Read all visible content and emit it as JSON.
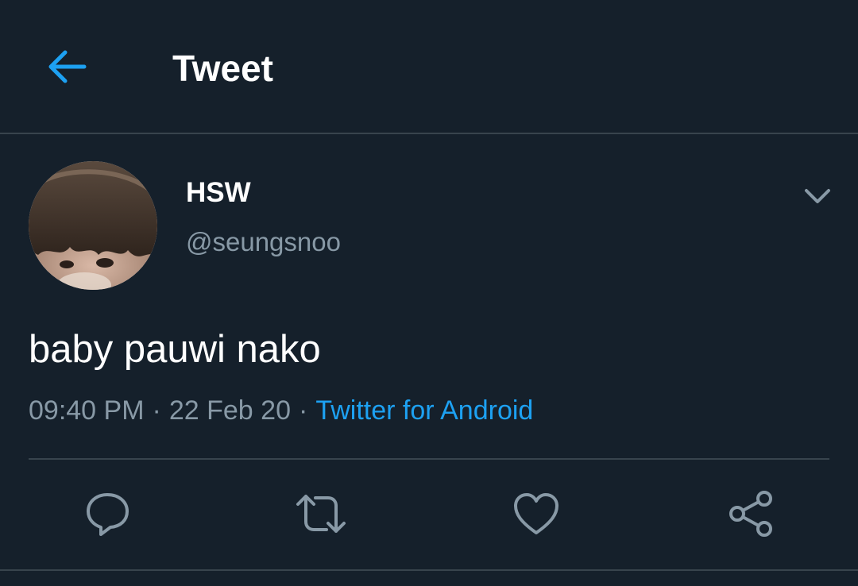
{
  "header": {
    "title": "Tweet",
    "back_icon": "arrow-left-icon"
  },
  "tweet": {
    "author": {
      "display_name": "HSW",
      "handle": "@seungsnoo"
    },
    "text": "baby pauwi nako",
    "time": "09:40 PM",
    "date": "22 Feb 20",
    "separator": "·",
    "source": "Twitter for Android"
  },
  "actions": [
    {
      "icon": "reply-icon"
    },
    {
      "icon": "retweet-icon"
    },
    {
      "icon": "like-icon"
    },
    {
      "icon": "share-icon"
    }
  ],
  "colors": {
    "background": "#15202b",
    "accent": "#1da1f2",
    "secondary_text": "#8899a6",
    "divider": "#38444d"
  }
}
